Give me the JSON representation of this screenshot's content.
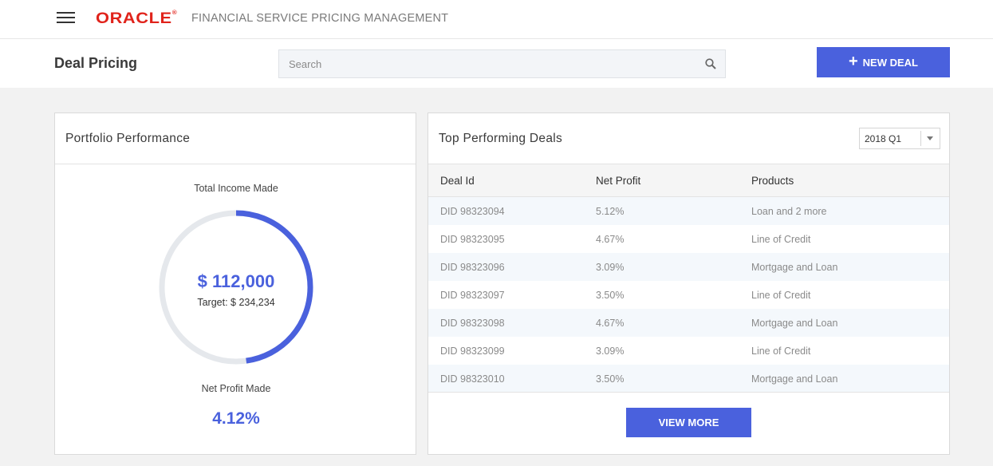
{
  "header": {
    "logo_text": "ORACLE",
    "app_title": "FINANCIAL SERVICE PRICING MANAGEMENT"
  },
  "subheader": {
    "page_title": "Deal Pricing",
    "search_placeholder": "Search",
    "new_deal_label": "NEW DEAL"
  },
  "portfolio": {
    "title": "Portfolio Performance",
    "income_label": "Total Income Made",
    "income_amount": "$ 112,000",
    "income_target": "Target: $ 234,234",
    "progress_fraction": 0.478,
    "net_profit_label": "Net Profit Made",
    "net_profit_value": "4.12%"
  },
  "top_deals": {
    "title": "Top Performing Deals",
    "period": "2018 Q1",
    "columns": [
      "Deal Id",
      "Net Profit",
      "Products"
    ],
    "rows": [
      [
        "DID 98323094",
        "5.12%",
        "Loan and 2 more"
      ],
      [
        "DID 98323095",
        "4.67%",
        "Line of Credit"
      ],
      [
        "DID 98323096",
        "3.09%",
        "Mortgage and Loan"
      ],
      [
        "DID 98323097",
        "3.50%",
        "Line of Credit"
      ],
      [
        "DID 98323098",
        "4.67%",
        "Mortgage and Loan"
      ],
      [
        "DID 98323099",
        "3.09%",
        "Line of Credit"
      ],
      [
        "DID 98323010",
        "3.50%",
        "Mortgage and Loan"
      ]
    ],
    "view_more_label": "VIEW MORE"
  },
  "colors": {
    "accent": "#4a61dd",
    "brand_red": "#e0231b",
    "ring_track": "#e5e8ec"
  }
}
